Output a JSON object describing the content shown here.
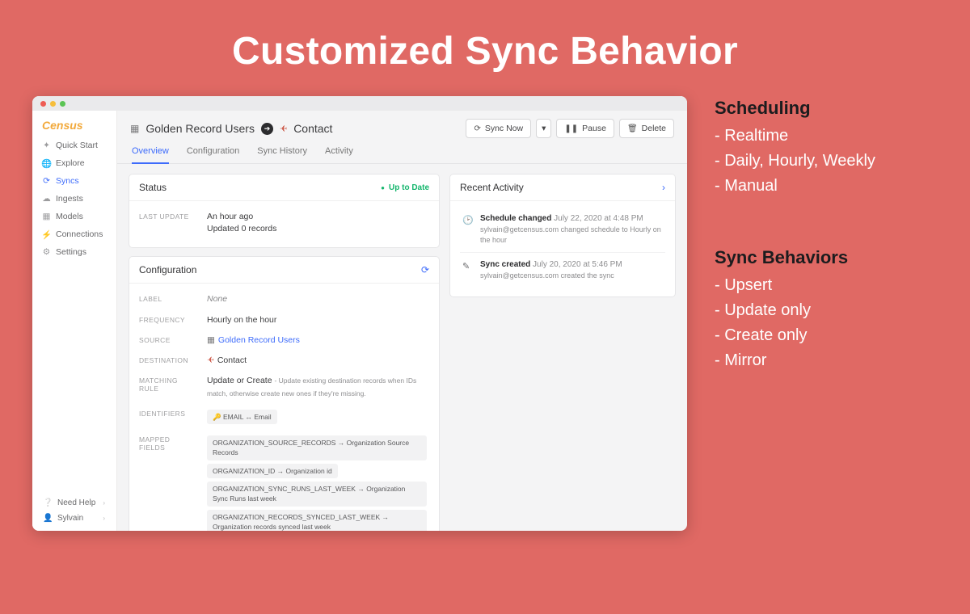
{
  "slide": {
    "title": "Customized Sync Behavior"
  },
  "brand": "Census",
  "nav": {
    "items": [
      {
        "label": "Quick Start",
        "icon": "bolt"
      },
      {
        "label": "Explore",
        "icon": "globe"
      },
      {
        "label": "Syncs",
        "icon": "refresh",
        "active": true
      },
      {
        "label": "Ingests",
        "icon": "cloud"
      },
      {
        "label": "Models",
        "icon": "grid"
      },
      {
        "label": "Connections",
        "icon": "plug"
      },
      {
        "label": "Settings",
        "icon": "gear"
      }
    ],
    "help": "Need Help",
    "user": "Sylvain"
  },
  "header": {
    "source": "Golden Record Users",
    "destination": "Contact",
    "actions": {
      "sync_now": "Sync Now",
      "pause": "Pause",
      "delete": "Delete"
    }
  },
  "tabs": [
    "Overview",
    "Configuration",
    "Sync History",
    "Activity"
  ],
  "status": {
    "title": "Status",
    "pill": "Up to Date",
    "last_update_label": "LAST UPDATE",
    "last_update_value": "An hour ago",
    "last_update_sub": "Updated 0 records"
  },
  "config": {
    "title": "Configuration",
    "rows": {
      "label": {
        "k": "LABEL",
        "v": "None",
        "italic": true
      },
      "frequency": {
        "k": "FREQUENCY",
        "v": "Hourly on the hour"
      },
      "source": {
        "k": "SOURCE",
        "v": "Golden Record Users",
        "link": true
      },
      "destination": {
        "k": "DESTINATION",
        "v": "Contact"
      },
      "matching": {
        "k": "MATCHING RULE",
        "v": "Update or Create",
        "note": "- Update existing destination records when IDs match, otherwise create new ones if they're missing."
      },
      "identifiers": {
        "k": "IDENTIFIERS",
        "pills": [
          "🔑  EMAIL ↔ Email"
        ]
      },
      "mapped": {
        "k": "MAPPED FIELDS",
        "pills": [
          "ORGANIZATION_SOURCE_RECORDS → Organization Source Records",
          "ORGANIZATION_ID → Organization id",
          "ORGANIZATION_SYNC_RUNS_LAST_WEEK → Organization Sync Runs last week",
          "ORGANIZATION_RECORDS_SYNCED_LAST_WEEK → Organization records synced last week"
        ]
      }
    }
  },
  "activity": {
    "title": "Recent Activity",
    "items": [
      {
        "icon": "clock",
        "title": "Schedule changed",
        "ts": "July 22, 2020 at 4:48 PM",
        "detail": "sylvain@getcensus.com changed schedule to Hourly on the hour"
      },
      {
        "icon": "edit",
        "title": "Sync created",
        "ts": "July 20, 2020 at 5:46 PM",
        "detail": "sylvain@getcensus.com created the sync"
      }
    ]
  },
  "info": {
    "scheduling": {
      "heading": "Scheduling",
      "items": [
        "Realtime",
        "Daily, Hourly, Weekly",
        "Manual"
      ]
    },
    "behaviors": {
      "heading": "Sync Behaviors",
      "items": [
        "Upsert",
        "Update only",
        "Create only",
        "Mirror"
      ]
    }
  }
}
